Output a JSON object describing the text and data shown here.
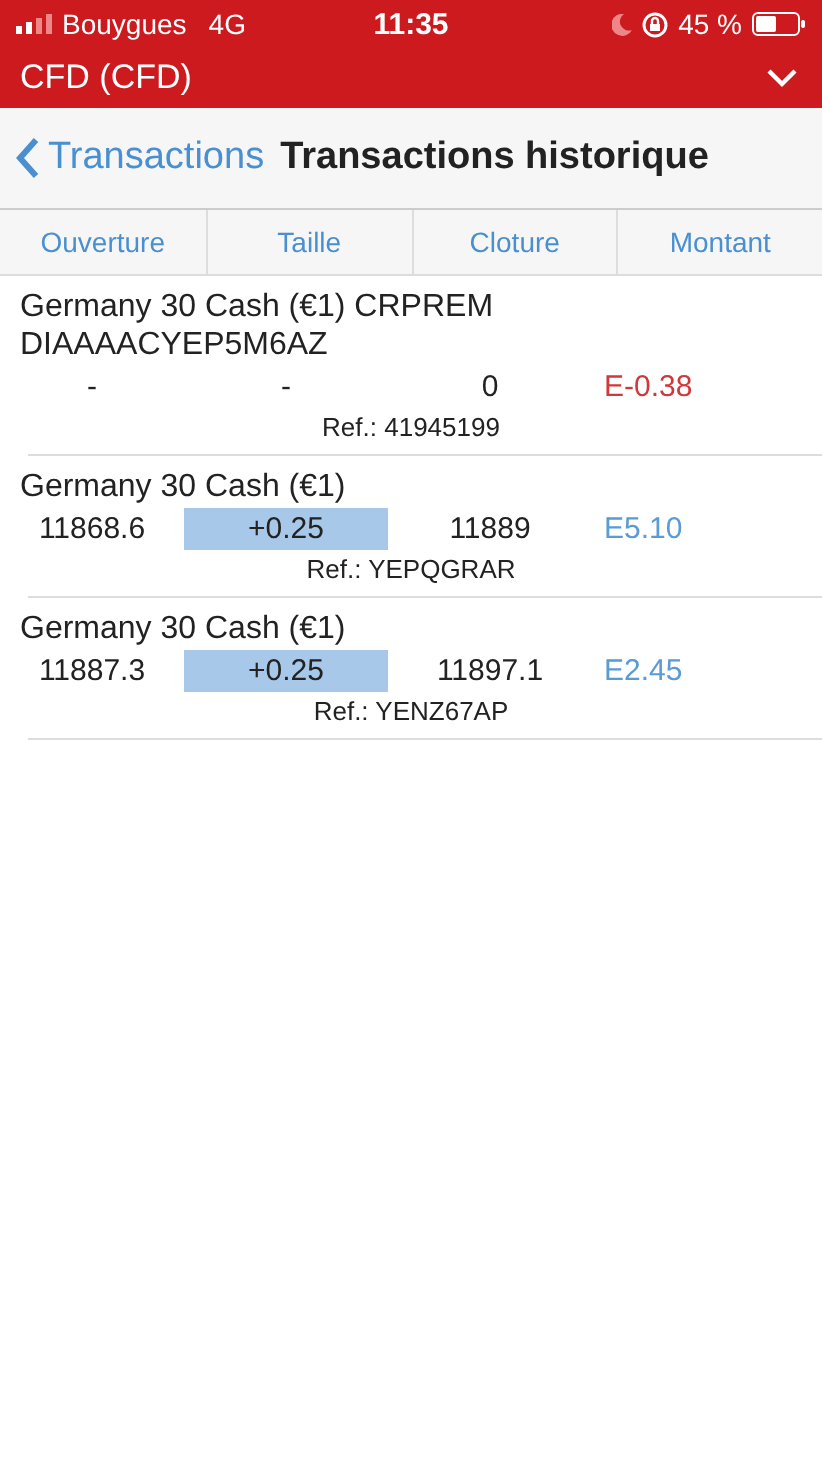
{
  "status_bar": {
    "carrier": "Bouygues",
    "network": "4G",
    "time": "11:35",
    "battery": "45 %"
  },
  "account_bar": {
    "title": "CFD (CFD)"
  },
  "nav": {
    "back": "Transactions",
    "title": "Transactions historique"
  },
  "columns": [
    "Ouverture",
    "Taille",
    "Cloture",
    "Montant"
  ],
  "rows": [
    {
      "name": "Germany 30 Cash (€1) CRPREM DIAAAACYEP5M6AZ",
      "opening": "-",
      "size": "-",
      "size_highlighted": false,
      "closing": "0",
      "amount": "E-0.38",
      "color": "#d0393b",
      "ref": "Ref.: 41945199"
    },
    {
      "name": "Germany 30 Cash (€1)",
      "opening": "11868.6",
      "size": "+0.25",
      "size_highlighted": true,
      "closing": "11889",
      "amount": "E5.10",
      "color": "#5a9bd5",
      "ref": "Ref.: YEPQGRAR"
    },
    {
      "name": "Germany 30 Cash (€1)",
      "opening": "11887.3",
      "size": "+0.25",
      "size_highlighted": true,
      "closing": "11897.1",
      "amount": "E2.45",
      "color": "#5a9bd5",
      "ref": "Ref.: YENZ67AP"
    }
  ]
}
